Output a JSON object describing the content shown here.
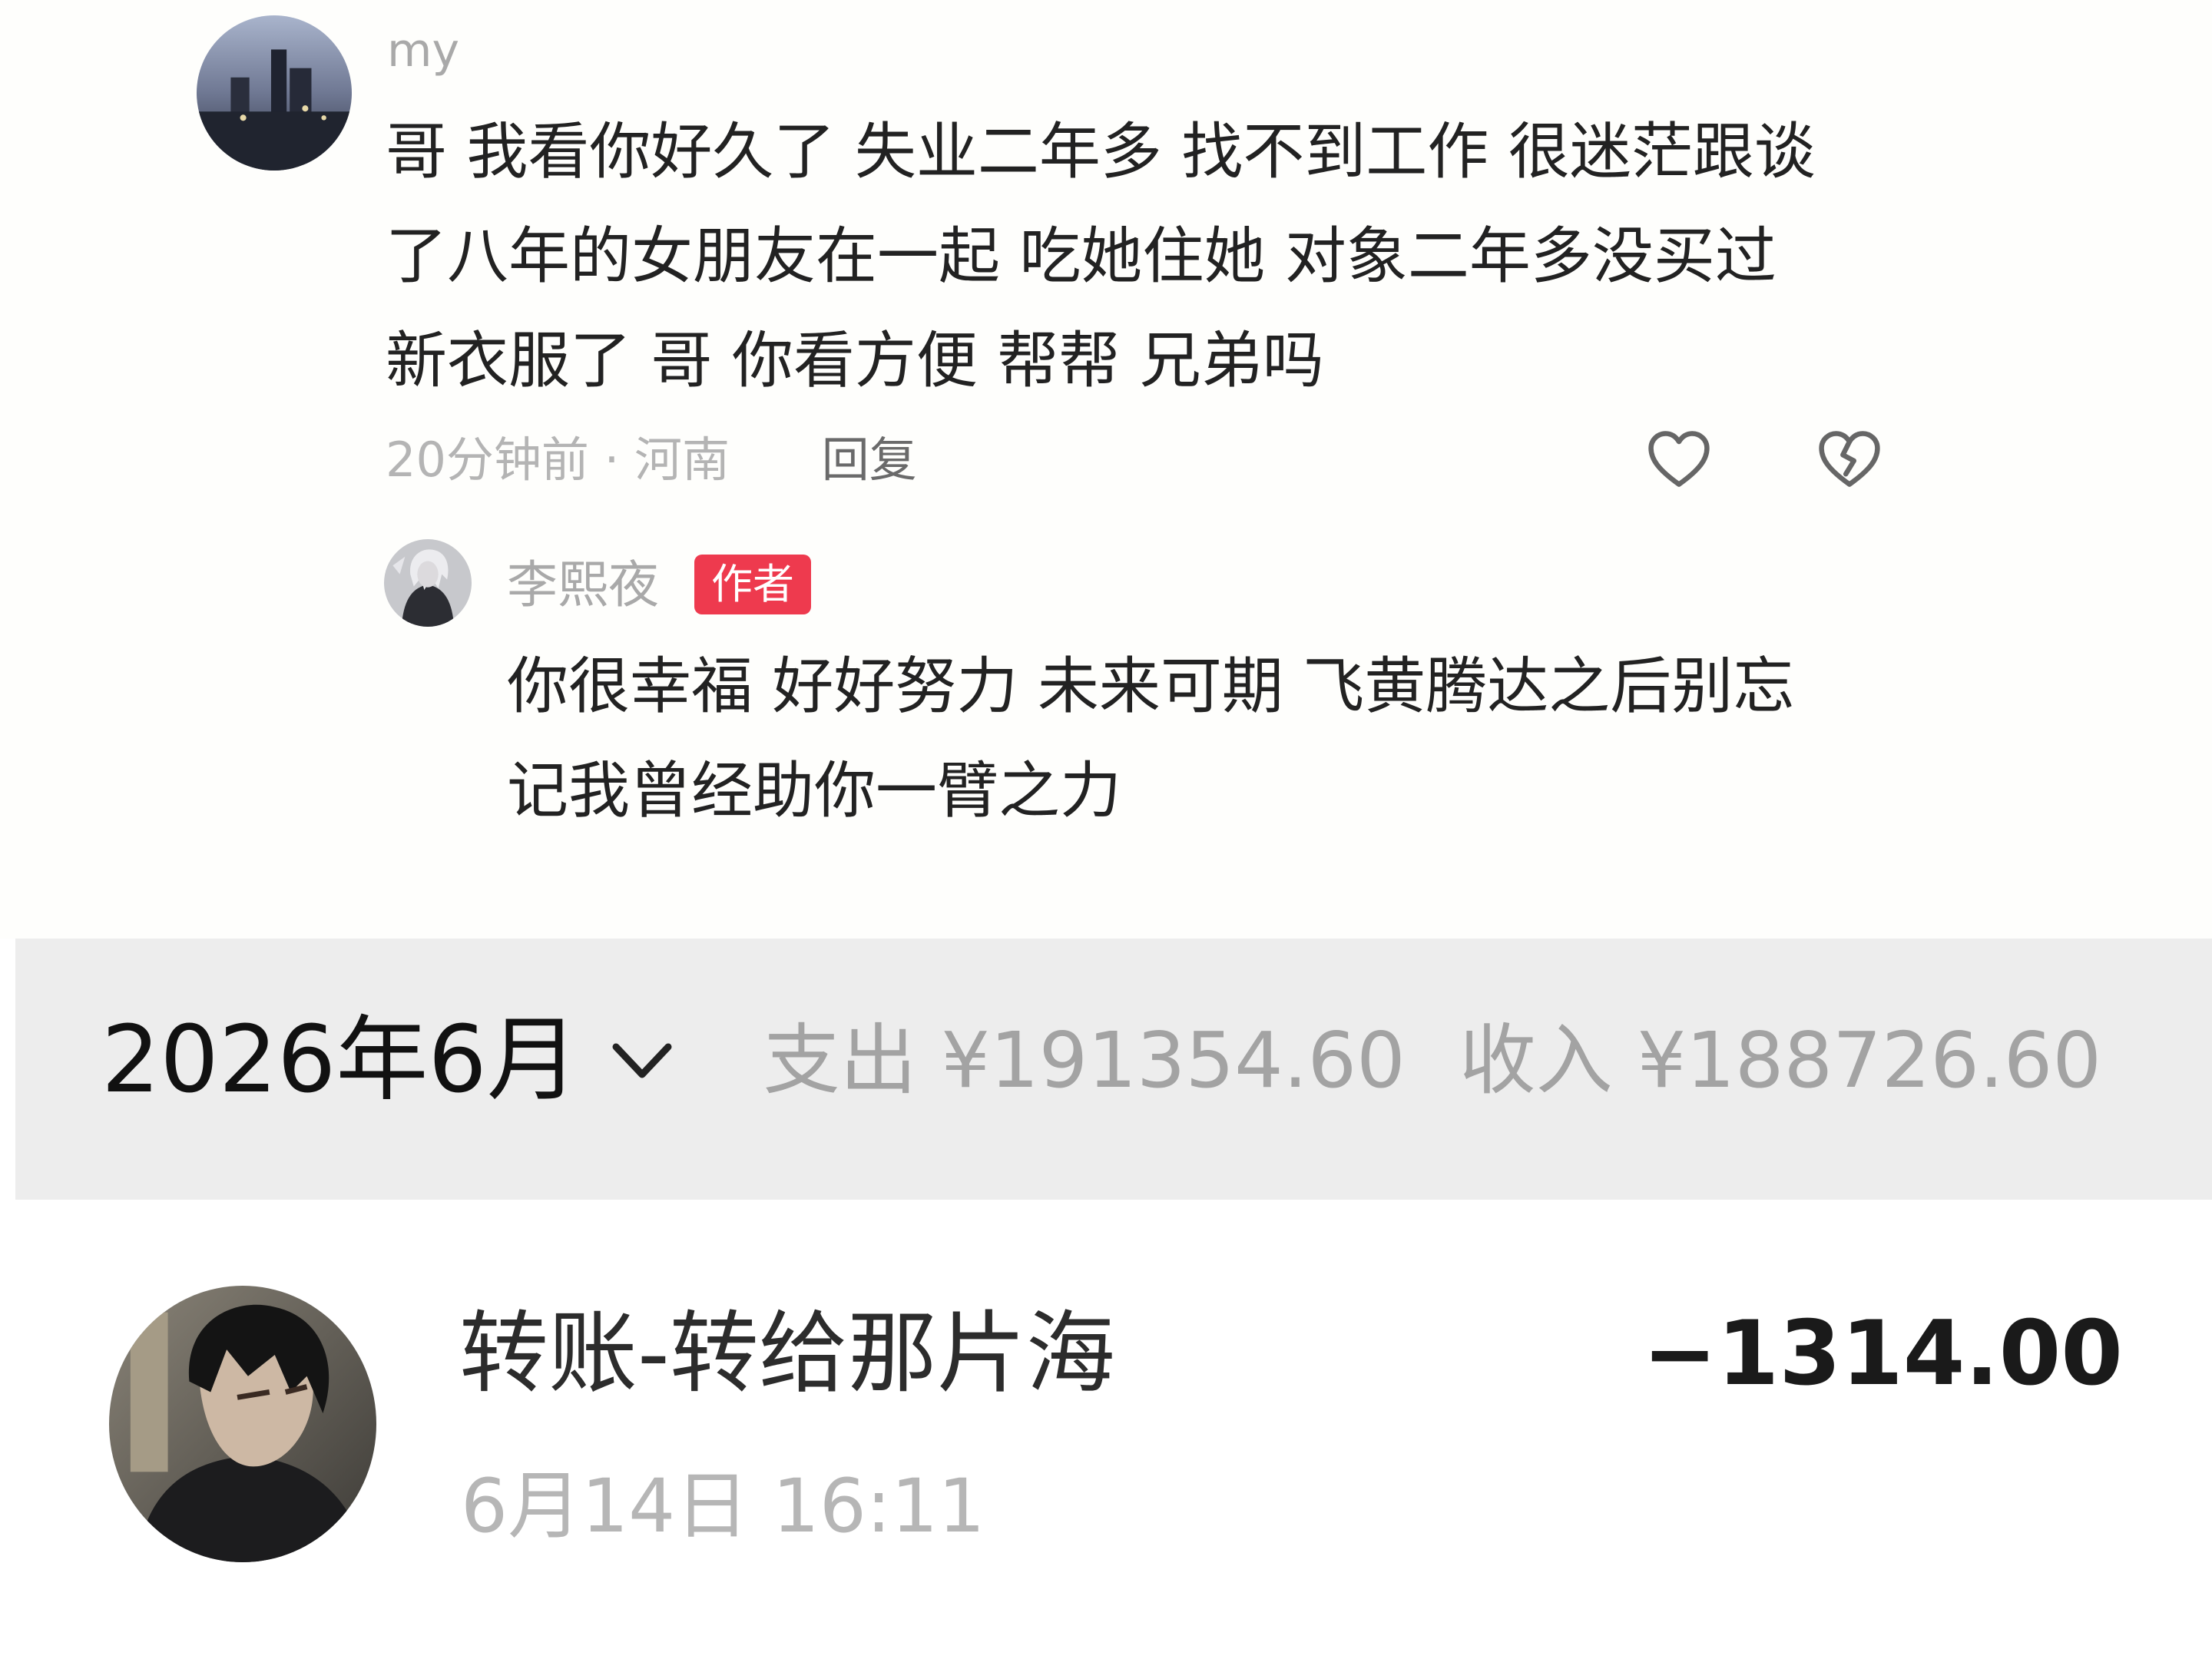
{
  "comment": {
    "username": "my",
    "lines": [
      "哥 我看你好久了 失业二年多 找不到工作 很迷茫跟谈",
      "了八年的女朋友在一起 吃她住她 对象二年多没买过",
      "新衣服了 哥 你看方便 帮帮 兄弟吗"
    ],
    "time_location": "20分钟前 · 河南",
    "reply_label": "回复",
    "like_icon": "heart-outline",
    "dislike_icon": "broken-heart-outline"
  },
  "author_reply": {
    "username": "李熙夜",
    "badge": "作者",
    "lines": [
      "你很幸福 好好努力 未来可期 飞黄腾达之后别忘",
      "记我曾经助你一臂之力"
    ]
  },
  "bill": {
    "month": "2026年6月",
    "expense": "支出 ¥191354.60",
    "income": "收入 ¥188726.60",
    "transaction": {
      "title": "转账-转给那片海",
      "amount": "−1314.00",
      "time": "6月14日 16:11"
    }
  },
  "colors": {
    "badge": "#ee3a4e",
    "summary_bg": "#ededed",
    "muted_text": "#a3a3a3"
  }
}
